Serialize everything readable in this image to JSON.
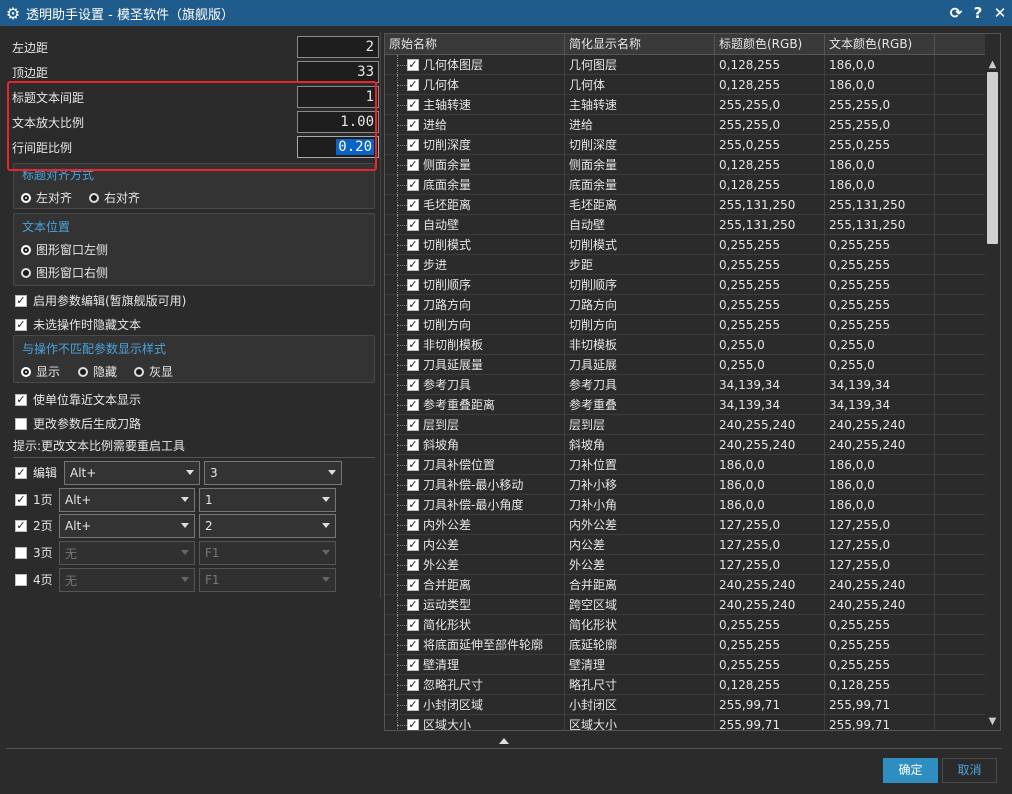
{
  "window": {
    "title": "透明助手设置 - 模圣软件（旗舰版）",
    "buttons": {
      "refresh": "⟳",
      "help": "?",
      "close": "✕"
    }
  },
  "params": [
    {
      "label": "左边距",
      "value": "2"
    },
    {
      "label": "顶边距",
      "value": "33"
    },
    {
      "label": "标题文本间距",
      "value": "1"
    },
    {
      "label": "文本放大比例",
      "value": "1.00"
    },
    {
      "label": "行间距比例",
      "value": "0.20"
    }
  ],
  "title_align": {
    "title": "标题对齐方式",
    "options": [
      "左对齐",
      "右对齐"
    ],
    "selected": 0
  },
  "text_pos": {
    "title": "文本位置",
    "options": [
      "图形窗口左侧",
      "图形窗口右侧"
    ],
    "selected": 0
  },
  "checks1": [
    {
      "label": "启用参数编辑(暂旗舰版可用)",
      "checked": true
    },
    {
      "label": "未选操作时隐藏文本",
      "checked": true
    }
  ],
  "mismatch": {
    "title": "与操作不匹配参数显示样式",
    "options": [
      "显示",
      "隐藏",
      "灰显"
    ],
    "selected": 0
  },
  "checks2": [
    {
      "label": "使单位靠近文本显示",
      "checked": true
    },
    {
      "label": "更改参数后生成刀路",
      "checked": false
    }
  ],
  "hint": "提示:更改文本比例需要重启工具",
  "hotkeys": [
    {
      "label": "编辑",
      "checked": true,
      "mod": "Alt+",
      "key": "3",
      "enabled": true
    },
    {
      "label": "1页",
      "checked": true,
      "mod": "Alt+",
      "key": "1",
      "enabled": true
    },
    {
      "label": "2页",
      "checked": true,
      "mod": "Alt+",
      "key": "2",
      "enabled": true
    },
    {
      "label": "3页",
      "checked": false,
      "mod": "无",
      "key": "F1",
      "enabled": false
    },
    {
      "label": "4页",
      "checked": false,
      "mod": "无",
      "key": "F1",
      "enabled": false
    }
  ],
  "table": {
    "headers": [
      "原始名称",
      "简化显示名称",
      "标题颜色(RGB)",
      "文本颜色(RGB)"
    ],
    "rows": [
      [
        "几何体图层",
        "几何图层",
        "0,128,255",
        "186,0,0"
      ],
      [
        "几何体",
        "几何体",
        "0,128,255",
        "186,0,0"
      ],
      [
        "主轴转速",
        "主轴转速",
        "255,255,0",
        "255,255,0"
      ],
      [
        "进给",
        "进给",
        "255,255,0",
        "255,255,0"
      ],
      [
        "切削深度",
        "切削深度",
        "255,0,255",
        "255,0,255"
      ],
      [
        "侧面余量",
        "侧面余量",
        "0,128,255",
        "186,0,0"
      ],
      [
        "底面余量",
        "底面余量",
        "0,128,255",
        "186,0,0"
      ],
      [
        "毛坯距离",
        "毛坯距离",
        "255,131,250",
        "255,131,250"
      ],
      [
        "自动壁",
        "自动壁",
        "255,131,250",
        "255,131,250"
      ],
      [
        "切削模式",
        "切削模式",
        "0,255,255",
        "0,255,255"
      ],
      [
        "步进",
        "步距",
        "0,255,255",
        "0,255,255"
      ],
      [
        "切削顺序",
        "切削顺序",
        "0,255,255",
        "0,255,255"
      ],
      [
        "刀路方向",
        "刀路方向",
        "0,255,255",
        "0,255,255"
      ],
      [
        "切削方向",
        "切削方向",
        "0,255,255",
        "0,255,255"
      ],
      [
        "非切削模板",
        "非切模板",
        "0,255,0",
        "0,255,0"
      ],
      [
        "刀具延展量",
        "刀具延展",
        "0,255,0",
        "0,255,0"
      ],
      [
        "参考刀具",
        "参考刀具",
        "34,139,34",
        "34,139,34"
      ],
      [
        "参考重叠距离",
        "参考重叠",
        "34,139,34",
        "34,139,34"
      ],
      [
        "层到层",
        "层到层",
        "240,255,240",
        "240,255,240"
      ],
      [
        "斜坡角",
        "斜坡角",
        "240,255,240",
        "240,255,240"
      ],
      [
        "刀具补偿位置",
        "刀补位置",
        "186,0,0",
        "186,0,0"
      ],
      [
        "刀具补偿-最小移动",
        "刀补小移",
        "186,0,0",
        "186,0,0"
      ],
      [
        "刀具补偿-最小角度",
        "刀补小角",
        "186,0,0",
        "186,0,0"
      ],
      [
        "内外公差",
        "内外公差",
        "127,255,0",
        "127,255,0"
      ],
      [
        "内公差",
        "内公差",
        "127,255,0",
        "127,255,0"
      ],
      [
        "外公差",
        "外公差",
        "127,255,0",
        "127,255,0"
      ],
      [
        "合并距离",
        "合并距离",
        "240,255,240",
        "240,255,240"
      ],
      [
        "运动类型",
        "跨空区域",
        "240,255,240",
        "240,255,240"
      ],
      [
        "简化形状",
        "简化形状",
        "0,255,255",
        "0,255,255"
      ],
      [
        "将底面延伸至部件轮廓",
        "底延轮廓",
        "0,255,255",
        "0,255,255"
      ],
      [
        "壁清理",
        "壁清理",
        "0,255,255",
        "0,255,255"
      ],
      [
        "忽略孔尺寸",
        "略孔尺寸",
        "0,128,255",
        "0,128,255"
      ],
      [
        "小封闭区域",
        "小封闭区",
        "255,99,71",
        "255,99,71"
      ],
      [
        "区域大小",
        "区域大小",
        "255,99,71",
        "255,99,71"
      ]
    ]
  },
  "buttons": {
    "ok": "确定",
    "cancel": "取消"
  }
}
